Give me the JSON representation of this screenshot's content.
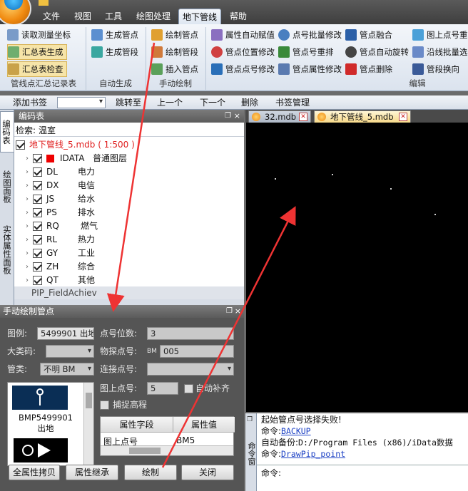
{
  "menu_tabs": [
    "文件",
    "视图",
    "工具",
    "绘图处理",
    "地下管线",
    "帮助"
  ],
  "ribbon": {
    "group1": {
      "label": "管线点汇总记录表",
      "items": [
        "读取测量坐标",
        "汇总表生成",
        "汇总表检查"
      ]
    },
    "group2": {
      "label": "自动生成",
      "items": [
        "生成管点",
        "生成管段"
      ]
    },
    "group3": {
      "label": "手动绘制",
      "items": [
        "绘制管点",
        "绘制管段",
        "插入管点"
      ]
    },
    "group4": {
      "label": "编辑",
      "items": [
        "属性自动赋值",
        "点号批量修改",
        "管点融合",
        "图上点号重排",
        "管点位置修改",
        "管点号重排",
        "管点自动旋转",
        "沿线批量选中",
        "管点点号修改",
        "管点属性修改",
        "管点删除",
        "管段换向"
      ]
    }
  },
  "bookmark_bar": [
    "添加书签",
    "跳转至",
    "上一个",
    "下一个",
    "删除",
    "书签管理"
  ],
  "vertical_tabs": [
    "编码表",
    "绘图面板",
    "实体属性面板"
  ],
  "code_panel": {
    "title": "编码表",
    "search_label": "检索:",
    "search_value": "温室",
    "root": "地下管线_5.mdb ( 1:500 )",
    "layers": [
      {
        "code": "IDATA",
        "name": "普通图层"
      },
      {
        "code": "DL",
        "name": "电力"
      },
      {
        "code": "DX",
        "name": "电信"
      },
      {
        "code": "JS",
        "name": "给水"
      },
      {
        "code": "PS",
        "name": "排水"
      },
      {
        "code": "RQ",
        "name": "燃气"
      },
      {
        "code": "RL",
        "name": "热力"
      },
      {
        "code": "GY",
        "name": "工业"
      },
      {
        "code": "ZH",
        "name": "综合"
      },
      {
        "code": "QT",
        "name": "其他"
      }
    ],
    "footer_item": "PIP_FieldAchiev"
  },
  "manual_panel": {
    "title": "手动绘制管点",
    "legend_label": "图例:",
    "legend_value": "5499901  出地",
    "digits_label": "点号位数:",
    "digits_value": "3",
    "big_class_label": "大类码:",
    "probe_label": "物探点号:",
    "probe_prefix": "BM",
    "probe_value": "005",
    "pipe_type_label": "管类:",
    "pipe_type_value": "不明  BM",
    "connect_label": "连接点号:",
    "map_point_label": "图上点号:",
    "map_point_value": "5",
    "auto_fill_label": "自动补齐",
    "snap_label": "捕捉高程",
    "symbol_caption": "BMP5499901\n出地",
    "table_headers": [
      "属性字段",
      "属性值"
    ],
    "table_row": [
      "图上点号",
      "BM5"
    ],
    "buttons": [
      "全属性拷贝",
      "属性继承",
      "绘制",
      "关闭"
    ]
  },
  "doc_tabs": [
    "32.mdb",
    "地下管线_5.mdb"
  ],
  "command": {
    "strip_label": "命令窗",
    "lines": [
      {
        "text": "起始管点号选择失败!"
      },
      {
        "prefix": "命令:",
        "link": "BACKUP"
      },
      {
        "prefix": "自动备份:",
        "text": "D:/Program Files (x86)/iData数据"
      },
      {
        "prefix": "命令:",
        "link": "DrawPip_point"
      }
    ],
    "prompt": "命令:"
  }
}
